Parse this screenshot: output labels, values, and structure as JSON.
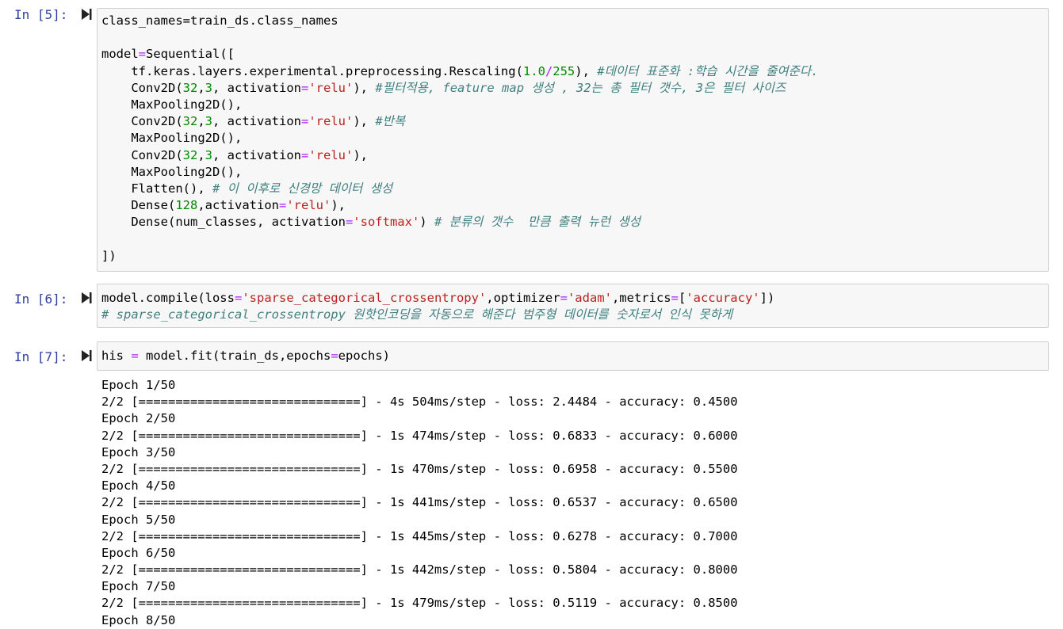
{
  "cells": [
    {
      "prompt": "In [5]:",
      "lines": [
        [
          {
            "t": "class_names=train_ds.class_names"
          }
        ],
        [],
        [
          {
            "t": "model"
          },
          {
            "t": "=",
            "c": "kw"
          },
          {
            "t": "Sequential(["
          }
        ],
        [
          {
            "t": "    tf.keras.layers.experimental.preprocessing.Rescaling("
          },
          {
            "t": "1.0",
            "c": "num"
          },
          {
            "t": "/",
            "c": "kw"
          },
          {
            "t": "255",
            "c": "num"
          },
          {
            "t": "), "
          },
          {
            "t": "#데이터 표준화 :학습 시간을 줄여준다.",
            "c": "cm"
          }
        ],
        [
          {
            "t": "    Conv2D("
          },
          {
            "t": "32",
            "c": "num"
          },
          {
            "t": ","
          },
          {
            "t": "3",
            "c": "num"
          },
          {
            "t": ", activation"
          },
          {
            "t": "=",
            "c": "kw"
          },
          {
            "t": "'relu'",
            "c": "str"
          },
          {
            "t": "), "
          },
          {
            "t": "#필터적용, feature map 생성 , 32는 총 필터 갯수, 3은 필터 사이즈",
            "c": "cm"
          }
        ],
        [
          {
            "t": "    MaxPooling2D(),"
          }
        ],
        [
          {
            "t": "    Conv2D("
          },
          {
            "t": "32",
            "c": "num"
          },
          {
            "t": ","
          },
          {
            "t": "3",
            "c": "num"
          },
          {
            "t": ", activation"
          },
          {
            "t": "=",
            "c": "kw"
          },
          {
            "t": "'relu'",
            "c": "str"
          },
          {
            "t": "), "
          },
          {
            "t": "#반복",
            "c": "cm"
          }
        ],
        [
          {
            "t": "    MaxPooling2D(),"
          }
        ],
        [
          {
            "t": "    Conv2D("
          },
          {
            "t": "32",
            "c": "num"
          },
          {
            "t": ","
          },
          {
            "t": "3",
            "c": "num"
          },
          {
            "t": ", activation"
          },
          {
            "t": "=",
            "c": "kw"
          },
          {
            "t": "'relu'",
            "c": "str"
          },
          {
            "t": "),"
          }
        ],
        [
          {
            "t": "    MaxPooling2D(),"
          }
        ],
        [
          {
            "t": "    Flatten(), "
          },
          {
            "t": "# 이 이후로 신경망 데이터 생성",
            "c": "cm"
          }
        ],
        [
          {
            "t": "    Dense("
          },
          {
            "t": "128",
            "c": "num"
          },
          {
            "t": ",activation"
          },
          {
            "t": "=",
            "c": "kw"
          },
          {
            "t": "'relu'",
            "c": "str"
          },
          {
            "t": "),"
          }
        ],
        [
          {
            "t": "    Dense(num_classes, activation"
          },
          {
            "t": "=",
            "c": "kw"
          },
          {
            "t": "'softmax'",
            "c": "str"
          },
          {
            "t": ") "
          },
          {
            "t": "# 분류의 갯수  만큼 출력 뉴런 생성",
            "c": "cm"
          }
        ],
        [],
        [
          {
            "t": "])"
          }
        ]
      ]
    },
    {
      "prompt": "In [6]:",
      "lines": [
        [
          {
            "t": "model.compile(loss"
          },
          {
            "t": "=",
            "c": "kw"
          },
          {
            "t": "'sparse_categorical_crossentropy'",
            "c": "str"
          },
          {
            "t": ",optimizer"
          },
          {
            "t": "=",
            "c": "kw"
          },
          {
            "t": "'adam'",
            "c": "str"
          },
          {
            "t": ",metrics"
          },
          {
            "t": "=",
            "c": "kw"
          },
          {
            "t": "["
          },
          {
            "t": "'accuracy'",
            "c": "str"
          },
          {
            "t": "])"
          }
        ],
        [
          {
            "t": "# sparse_categorical_crossentropy 원핫인코딩을 자동으로 해준다 범주형 데이터를 숫자로서 인식 못하게",
            "c": "cm"
          }
        ]
      ]
    },
    {
      "prompt": "In [7]:",
      "lines": [
        [
          {
            "t": "his "
          },
          {
            "t": "=",
            "c": "kw"
          },
          {
            "t": " model.fit(train_ds,epochs"
          },
          {
            "t": "=",
            "c": "kw"
          },
          {
            "t": "epochs)"
          }
        ]
      ]
    }
  ],
  "output_lines": [
    "Epoch 1/50",
    "2/2 [==============================] - 4s 504ms/step - loss: 2.4484 - accuracy: 0.4500",
    "Epoch 2/50",
    "2/2 [==============================] - 1s 474ms/step - loss: 0.6833 - accuracy: 0.6000",
    "Epoch 3/50",
    "2/2 [==============================] - 1s 470ms/step - loss: 0.6958 - accuracy: 0.5500",
    "Epoch 4/50",
    "2/2 [==============================] - 1s 441ms/step - loss: 0.6537 - accuracy: 0.6500",
    "Epoch 5/50",
    "2/2 [==============================] - 1s 445ms/step - loss: 0.6278 - accuracy: 0.7000",
    "Epoch 6/50",
    "2/2 [==============================] - 1s 442ms/step - loss: 0.5804 - accuracy: 0.8000",
    "Epoch 7/50",
    "2/2 [==============================] - 1s 479ms/step - loss: 0.5119 - accuracy: 0.8500",
    "Epoch 8/50"
  ],
  "icons": {
    "run": "run-cell-icon"
  },
  "colors": {
    "prompt": "#303f9f",
    "keyword": "#aa22ff",
    "number": "#008800",
    "string": "#ba2121",
    "comment": "#408080"
  }
}
